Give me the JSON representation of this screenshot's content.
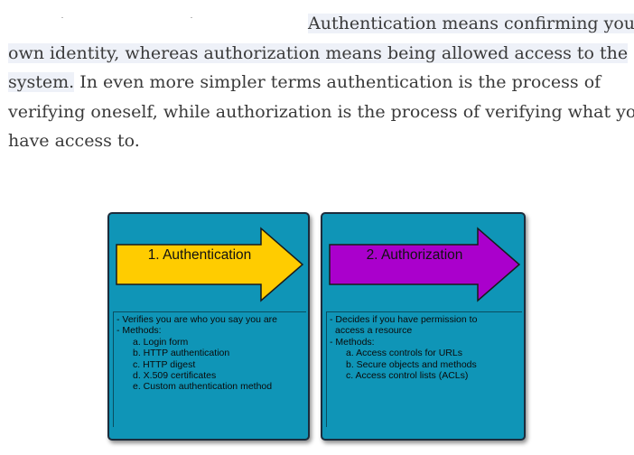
{
  "paragraph": {
    "line1": "Authentication means confirming your",
    "line2": "own identity, whereas authorization means being allowed access to the",
    "line3_highlighted": "system.",
    "line3_rest": " In even more simpler terms authentication is the process of",
    "line4": "verifying oneself, while authorization is the process of verifying what you",
    "line5": "have access to."
  },
  "diagram": {
    "authentication": {
      "label": "1. Authentication",
      "color": "#ffcc00",
      "notes": [
        {
          "text": "- Verifies you are who you say you are",
          "level": 0
        },
        {
          "text": "- Methods:",
          "level": 0
        },
        {
          "text": "a. Login form",
          "level": 1
        },
        {
          "text": "b. HTTP authentication",
          "level": 1
        },
        {
          "text": "c. HTTP digest",
          "level": 1
        },
        {
          "text": "d. X.509 certificates",
          "level": 1
        },
        {
          "text": "e. Custom authentication method",
          "level": 1
        }
      ]
    },
    "authorization": {
      "label": "2. Authorization",
      "color": "#aa00cc",
      "notes": [
        {
          "text": "- Decides if you have permission to",
          "level": 0
        },
        {
          "text": "access a resource",
          "level": 0
        },
        {
          "text": "- Methods:",
          "level": 0
        },
        {
          "text": "a. Access controls for URLs",
          "level": 1
        },
        {
          "text": "b. Secure objects and methods",
          "level": 1
        },
        {
          "text": "c. Access control lists (ACLs)",
          "level": 1
        }
      ]
    }
  }
}
